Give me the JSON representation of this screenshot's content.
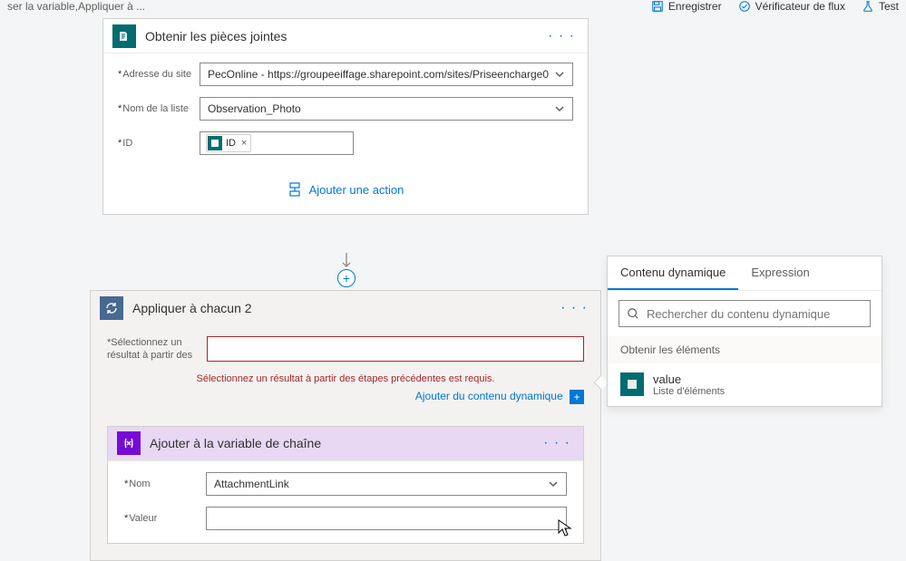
{
  "breadcrumb": "ser la variable,Appliquer à ...",
  "toolbar": {
    "save": "Enregistrer",
    "checker": "Vérificateur de flux",
    "test": "Test"
  },
  "card_attachments": {
    "title": "Obtenir les pièces jointes",
    "fields": {
      "site_label": "Adresse du site",
      "site_value": "PecOnline - https://groupeeiffage.sharepoint.com/sites/Priseencharge0",
      "list_label": "Nom de la liste",
      "list_value": "Observation_Photo",
      "id_label": "ID",
      "id_token": "ID"
    },
    "add_action": "Ajouter une action"
  },
  "card_loop": {
    "title": "Appliquer à chacun 2",
    "select_label": "Sélectionnez un résultat à partir des",
    "error_msg": "Sélectionnez un résultat à partir des étapes précédentes est requis.",
    "dyn_link": "Ajouter du contenu dynamique"
  },
  "card_var": {
    "title": "Ajouter à la variable de chaîne",
    "name_label": "Nom",
    "name_value": "AttachmentLink",
    "value_label": "Valeur"
  },
  "dc": {
    "tab_dynamic": "Contenu dynamique",
    "tab_expression": "Expression",
    "search_placeholder": "Rechercher du contenu dynamique",
    "group1": "Obtenir les éléments",
    "item1_title": "value",
    "item1_sub": "Liste d'éléments"
  }
}
